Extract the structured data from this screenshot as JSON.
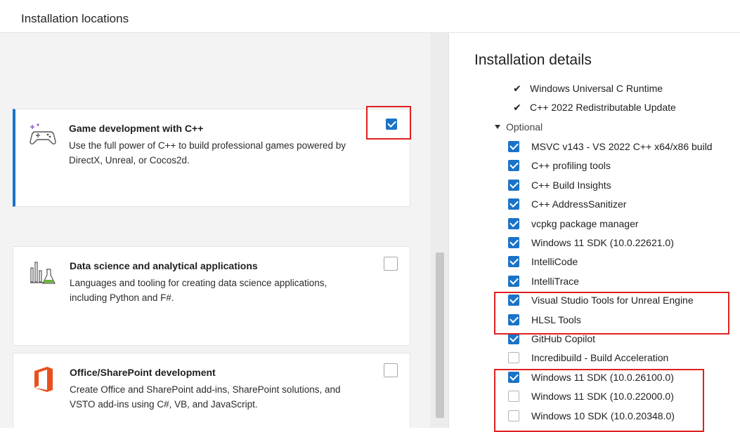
{
  "header": {
    "title": "Installation locations"
  },
  "workloads": [
    {
      "title": "Game development with C++",
      "description": "Use the full power of C++ to build professional games powered by DirectX, Unreal, or Cocos2d.",
      "checked": true,
      "icon": "gamepad-icon"
    },
    {
      "title": "Data science and analytical applications",
      "description": "Languages and tooling for creating data science applications, including Python and F#.",
      "checked": false,
      "icon": "data-science-icon"
    },
    {
      "title": "Office/SharePoint development",
      "description": "Create Office and SharePoint add-ins, SharePoint solutions, and VSTO add-ins using C#, VB, and JavaScript.",
      "checked": false,
      "icon": "office-icon"
    }
  ],
  "details": {
    "title": "Installation details",
    "included": [
      "Windows Universal C Runtime",
      "C++ 2022 Redistributable Update"
    ],
    "optional_label": "Optional",
    "optional": [
      {
        "label": "MSVC v143 - VS 2022 C++ x64/x86 build",
        "checked": true
      },
      {
        "label": "C++ profiling tools",
        "checked": true
      },
      {
        "label": "C++ Build Insights",
        "checked": true
      },
      {
        "label": "C++ AddressSanitizer",
        "checked": true
      },
      {
        "label": "vcpkg package manager",
        "checked": true
      },
      {
        "label": "Windows 11 SDK (10.0.22621.0)",
        "checked": true
      },
      {
        "label": "IntelliCode",
        "checked": true
      },
      {
        "label": "IntelliTrace",
        "checked": true
      },
      {
        "label": "Visual Studio Tools for Unreal Engine",
        "checked": true
      },
      {
        "label": "HLSL Tools",
        "checked": true
      },
      {
        "label": "GitHub Copilot",
        "checked": true
      },
      {
        "label": "Incredibuild - Build Acceleration",
        "checked": false
      },
      {
        "label": "Windows 11 SDK (10.0.26100.0)",
        "checked": true
      },
      {
        "label": "Windows 11 SDK (10.0.22000.0)",
        "checked": false
      },
      {
        "label": "Windows 10 SDK (10.0.20348.0)",
        "checked": false
      }
    ]
  },
  "colors": {
    "accent": "#1a73c8",
    "highlight": "#e02020"
  }
}
